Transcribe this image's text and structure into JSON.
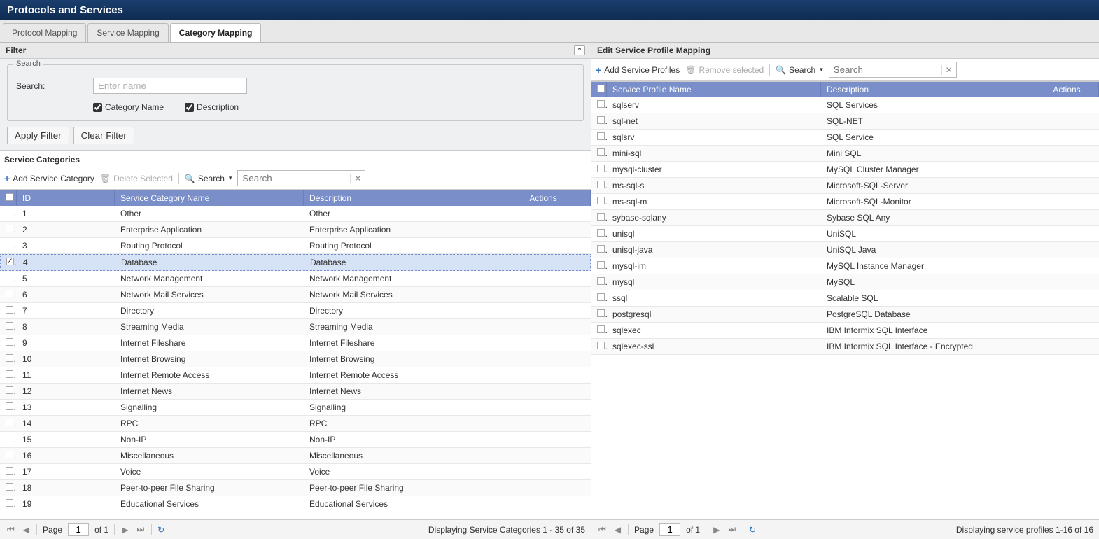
{
  "page_title": "Protocols and Services",
  "tabs": [
    {
      "label": "Protocol Mapping",
      "active": false
    },
    {
      "label": "Service Mapping",
      "active": false
    },
    {
      "label": "Category Mapping",
      "active": true
    }
  ],
  "filter": {
    "panel_title": "Filter",
    "legend": "Search",
    "search_label": "Search:",
    "search_placeholder": "Enter name",
    "check_category_name": "Category Name",
    "check_description": "Description",
    "apply_btn": "Apply Filter",
    "clear_btn": "Clear Filter"
  },
  "categories": {
    "section_title": "Service Categories",
    "add_btn": "Add Service Category",
    "delete_btn": "Delete Selected",
    "search_label": "Search",
    "search_placeholder": "Search",
    "headers": {
      "id": "ID",
      "name": "Service Category Name",
      "desc": "Description",
      "actions": "Actions"
    },
    "rows": [
      {
        "id": "1",
        "name": "Other",
        "desc": "Other",
        "checked": false
      },
      {
        "id": "2",
        "name": "Enterprise Application",
        "desc": "Enterprise Application",
        "checked": false
      },
      {
        "id": "3",
        "name": "Routing Protocol",
        "desc": "Routing Protocol",
        "checked": false
      },
      {
        "id": "4",
        "name": "Database",
        "desc": "Database",
        "checked": true,
        "selected": true
      },
      {
        "id": "5",
        "name": "Network Management",
        "desc": "Network Management",
        "checked": false
      },
      {
        "id": "6",
        "name": "Network Mail Services",
        "desc": "Network Mail Services",
        "checked": false
      },
      {
        "id": "7",
        "name": "Directory",
        "desc": "Directory",
        "checked": false
      },
      {
        "id": "8",
        "name": "Streaming Media",
        "desc": "Streaming Media",
        "checked": false
      },
      {
        "id": "9",
        "name": "Internet Fileshare",
        "desc": "Internet Fileshare",
        "checked": false
      },
      {
        "id": "10",
        "name": "Internet Browsing",
        "desc": "Internet Browsing",
        "checked": false
      },
      {
        "id": "11",
        "name": "Internet Remote Access",
        "desc": "Internet Remote Access",
        "checked": false
      },
      {
        "id": "12",
        "name": "Internet News",
        "desc": "Internet News",
        "checked": false
      },
      {
        "id": "13",
        "name": "Signalling",
        "desc": "Signalling",
        "checked": false
      },
      {
        "id": "14",
        "name": "RPC",
        "desc": "RPC",
        "checked": false
      },
      {
        "id": "15",
        "name": "Non-IP",
        "desc": "Non-IP",
        "checked": false
      },
      {
        "id": "16",
        "name": "Miscellaneous",
        "desc": "Miscellaneous",
        "checked": false
      },
      {
        "id": "17",
        "name": "Voice",
        "desc": "Voice",
        "checked": false
      },
      {
        "id": "18",
        "name": "Peer-to-peer File Sharing",
        "desc": "Peer-to-peer File Sharing",
        "checked": false
      },
      {
        "id": "19",
        "name": "Educational Services",
        "desc": "Educational Services",
        "checked": false
      }
    ],
    "paging": {
      "page_label": "Page",
      "page": "1",
      "of_label": "of 1",
      "status": "Displaying Service Categories 1 - 35 of 35"
    }
  },
  "profiles": {
    "panel_title": "Edit Service Profile Mapping",
    "add_btn": "Add Service Profiles",
    "remove_btn": "Remove selected",
    "search_label": "Search",
    "search_placeholder": "Search",
    "headers": {
      "name": "Service Profile Name",
      "desc": "Description",
      "actions": "Actions"
    },
    "rows": [
      {
        "name": "sqlserv",
        "desc": "SQL Services"
      },
      {
        "name": "sql-net",
        "desc": "SQL-NET"
      },
      {
        "name": "sqlsrv",
        "desc": "SQL Service"
      },
      {
        "name": "mini-sql",
        "desc": "Mini SQL"
      },
      {
        "name": "mysql-cluster",
        "desc": "MySQL Cluster Manager"
      },
      {
        "name": "ms-sql-s",
        "desc": "Microsoft-SQL-Server"
      },
      {
        "name": "ms-sql-m",
        "desc": "Microsoft-SQL-Monitor"
      },
      {
        "name": "sybase-sqlany",
        "desc": "Sybase SQL Any"
      },
      {
        "name": "unisql",
        "desc": "UniSQL"
      },
      {
        "name": "unisql-java",
        "desc": "UniSQL Java"
      },
      {
        "name": "mysql-im",
        "desc": "MySQL Instance Manager"
      },
      {
        "name": "mysql",
        "desc": "MySQL"
      },
      {
        "name": "ssql",
        "desc": "Scalable SQL"
      },
      {
        "name": "postgresql",
        "desc": "PostgreSQL Database"
      },
      {
        "name": "sqlexec",
        "desc": "IBM Informix SQL Interface"
      },
      {
        "name": "sqlexec-ssl",
        "desc": "IBM Informix SQL Interface - Encrypted"
      }
    ],
    "paging": {
      "page_label": "Page",
      "page": "1",
      "of_label": "of 1",
      "status": "Displaying service profiles 1-16 of 16"
    }
  }
}
